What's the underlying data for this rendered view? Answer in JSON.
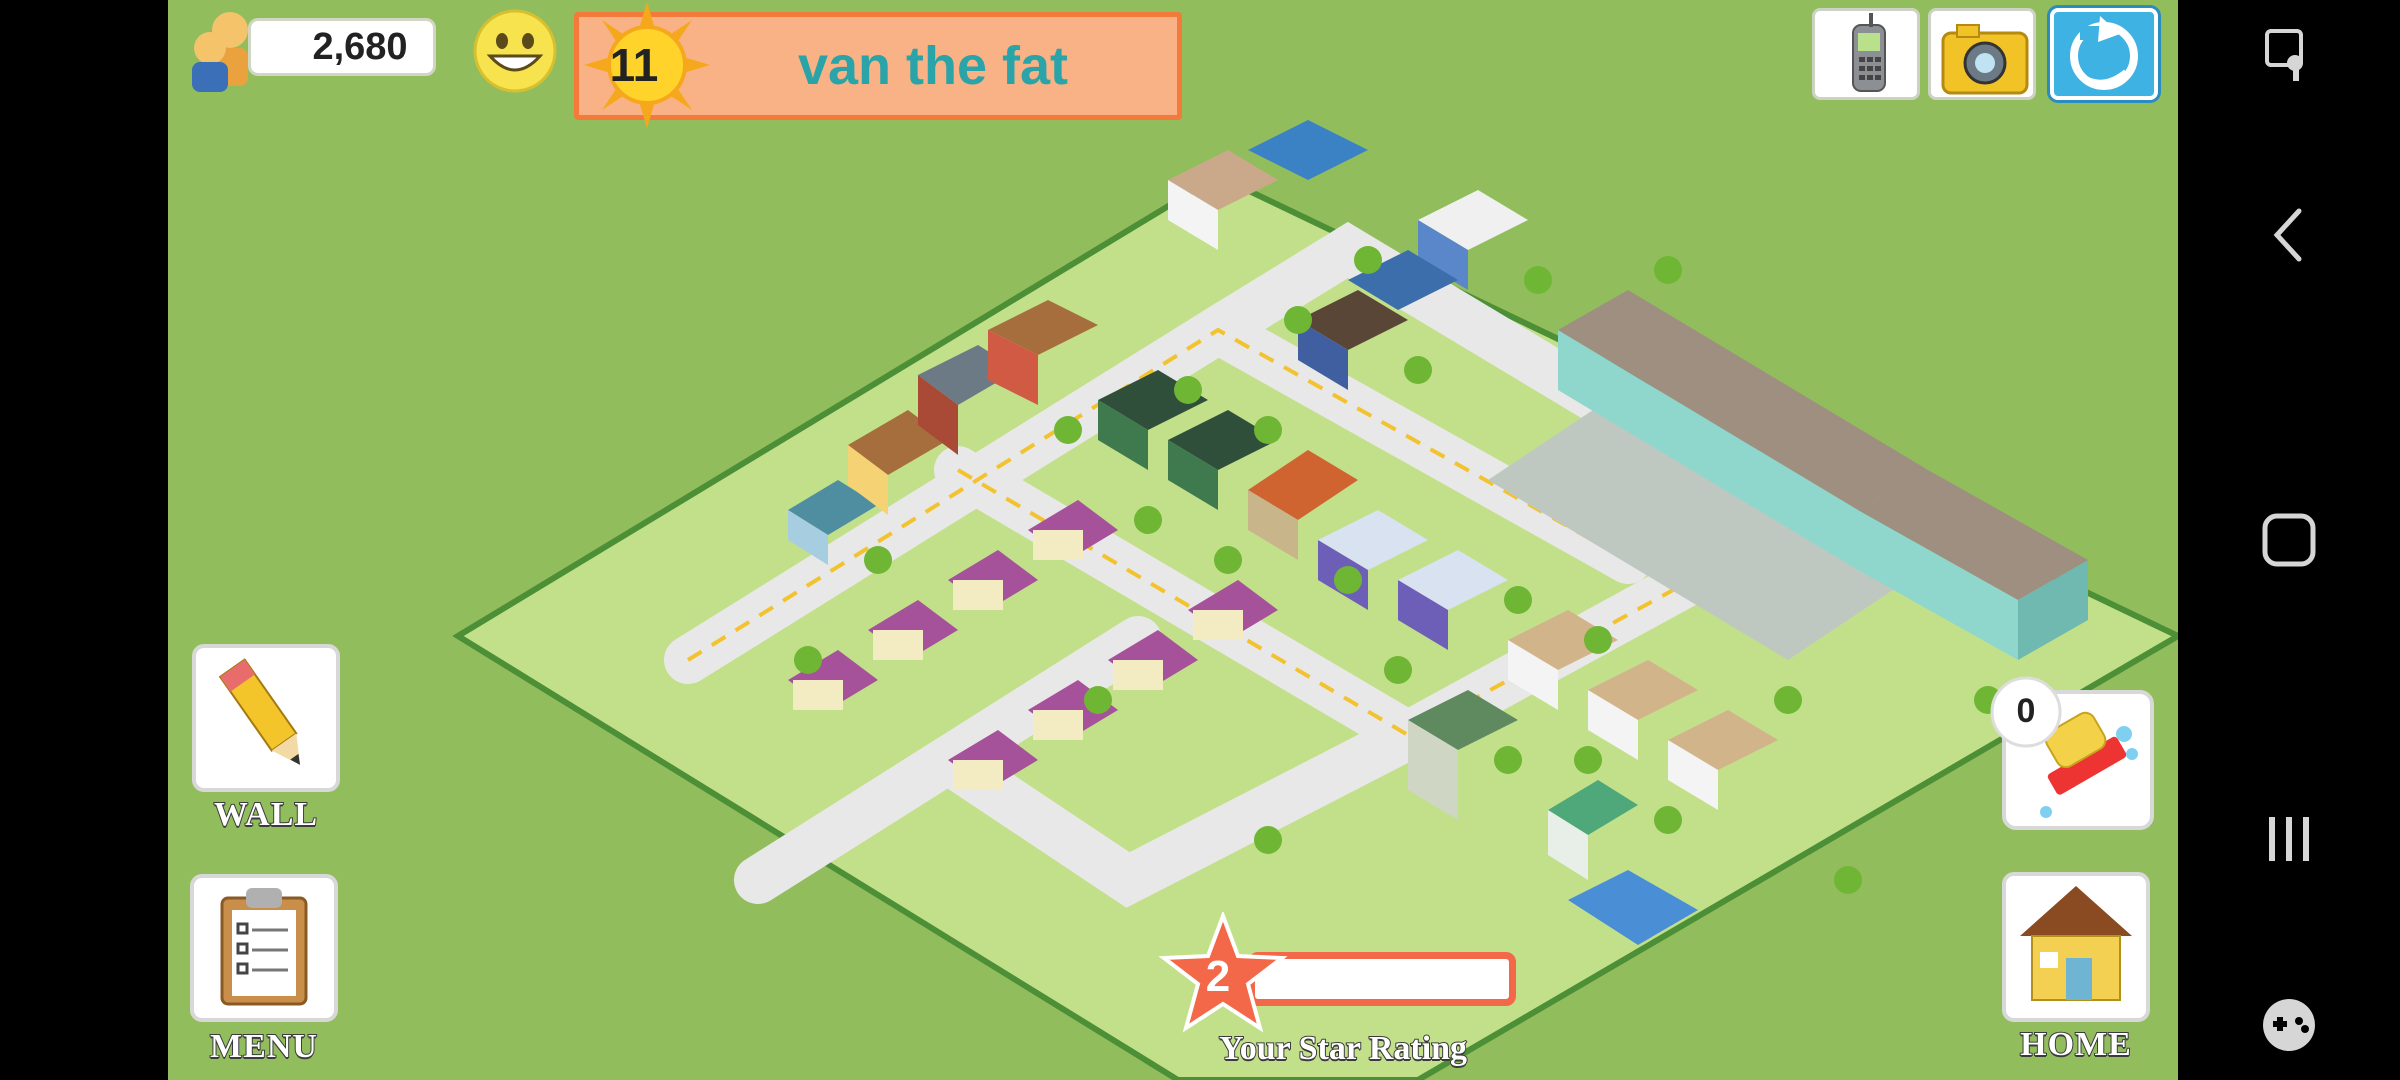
{
  "hud": {
    "population": "2,680",
    "level": "11",
    "player_name": "van the fat",
    "star_rating_value": "2",
    "star_rating_label": "Your Star Rating",
    "star_progress": 0.0,
    "cleanup_count": "0"
  },
  "side_buttons": {
    "wall_label": "WALL",
    "menu_label": "MENU",
    "home_label": "HOME"
  },
  "top_buttons": [
    "phone",
    "camera",
    "share"
  ],
  "android_nav": [
    "screen-pin",
    "back",
    "home",
    "recents",
    "game-tools"
  ],
  "colors": {
    "grass": "#92bd5c",
    "lot": "#c4e38c",
    "road": "#e6e6e6",
    "banner": "#f9b285",
    "banner_border": "#f37a3a",
    "name_text": "#2aa4a8",
    "star": "#f36848"
  }
}
